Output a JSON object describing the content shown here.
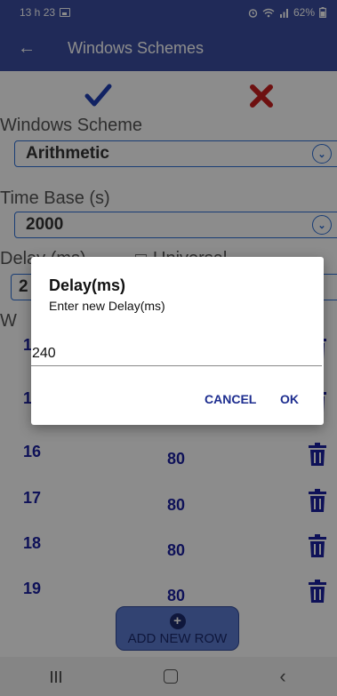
{
  "status_bar": {
    "time": "13 h 23",
    "battery": "62%"
  },
  "app_bar": {
    "title": "Windows Schemes"
  },
  "form": {
    "scheme_label": "Windows Scheme",
    "scheme_value": "Arithmetic",
    "time_base_label": "Time Base (s)",
    "time_base_value": "2000",
    "delay_label": "Delay (ms)",
    "universal_label": "Universal",
    "delay_value": "2",
    "windows_label": "W"
  },
  "rows": [
    {
      "id": "1",
      "value": ""
    },
    {
      "id": "1",
      "value": ""
    },
    {
      "id": "16",
      "value": "80"
    },
    {
      "id": "17",
      "value": "80"
    },
    {
      "id": "18",
      "value": "80"
    },
    {
      "id": "19",
      "value": "80"
    }
  ],
  "add_button": {
    "label": "ADD NEW ROW"
  },
  "dialog": {
    "title": "Delay(ms)",
    "message": "Enter new Delay(ms)",
    "input_value": "240",
    "cancel_label": "CANCEL",
    "ok_label": "OK"
  },
  "icons": {
    "back": "arrow-back-icon",
    "confirm": "check-icon",
    "discard": "close-icon",
    "dropdown": "chevron-down-icon",
    "delete": "trash-icon",
    "add": "plus-icon"
  },
  "colors": {
    "primary": "#3b4da0",
    "accent": "#2f6fd6",
    "check": "#1f3fb5",
    "cross": "#c81e1e",
    "row_text": "#1a1fa0"
  }
}
